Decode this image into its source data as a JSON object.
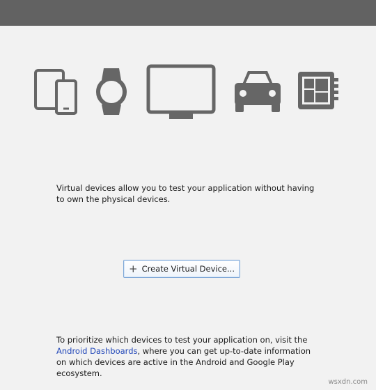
{
  "icons": [
    "phone-tablet-icon",
    "wear-watch-icon",
    "tv-icon",
    "car-icon",
    "things-board-icon"
  ],
  "intro": {
    "text": "Virtual devices allow you to test your application without having to own the physical devices."
  },
  "create_button": {
    "icon": "plus-icon",
    "label": "Create Virtual Device..."
  },
  "footer": {
    "text_before": "To prioritize which devices to test your application on, visit the ",
    "link": "Android Dashboards",
    "text_after": ", where you can get up-to-date information on which devices are active in the Android and Google Play ecosystem."
  },
  "watermark": "wsxdn.com",
  "colors": {
    "title_bar": "#626262",
    "background": "#f2f2f2",
    "icon": "#666666",
    "link": "#2046b8",
    "button_border": "#7fa8d8"
  }
}
